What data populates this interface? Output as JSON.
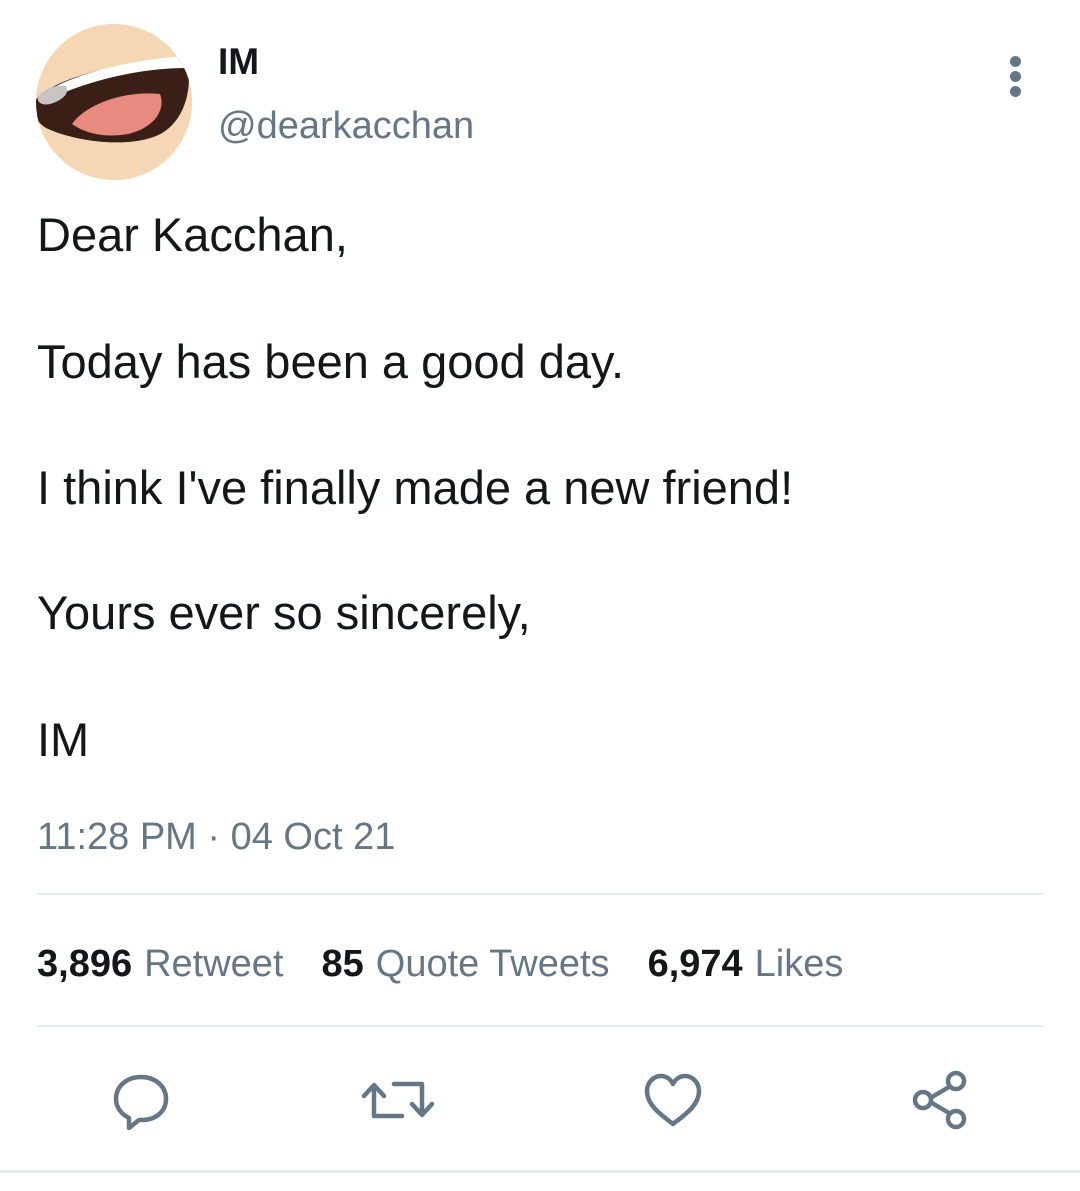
{
  "user": {
    "display_name": "IM",
    "handle": "@dearkacchan",
    "avatar_icon": "open-mouth-avatar"
  },
  "tweet": {
    "lines": [
      "Dear Kacchan,",
      "Today has been a good day.",
      "I think I've finally made a new friend!",
      "Yours ever so sincerely,",
      "IM"
    ],
    "timestamp": "11:28 PM · 04 Oct 21"
  },
  "stats": {
    "retweets": {
      "count": "3,896",
      "label": "Retweet"
    },
    "quotes": {
      "count": "85",
      "label": "Quote Tweets"
    },
    "likes": {
      "count": "6,974",
      "label": "Likes"
    }
  },
  "actions": [
    {
      "icon": "reply-icon"
    },
    {
      "icon": "retweet-icon"
    },
    {
      "icon": "heart-icon"
    },
    {
      "icon": "share-icon"
    }
  ],
  "colors": {
    "text": "#14171a",
    "secondary_text": "#657786",
    "divider": "#e6ecf0",
    "avatar_background": "#f6d7b5"
  }
}
